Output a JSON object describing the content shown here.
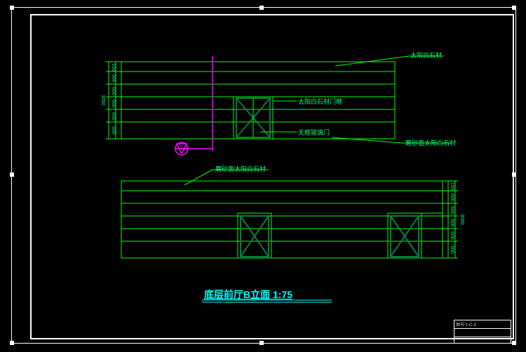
{
  "drawing": {
    "title": "底层前厅B立面 1:75",
    "scale": "1:75",
    "labels": {
      "top_stone": "太阳白石材",
      "door_frame": "太阳白石材门框",
      "glass_door": "无框玻璃门",
      "polished_stone": "磨砂面太阳白石材",
      "polished_stone2": "磨砂面太阳白石材"
    },
    "dims_upper": {
      "total": "3050",
      "d1": "500",
      "d2": "600",
      "d3": "600",
      "d4": "600",
      "d5": "600",
      "d6": "150"
    },
    "dims_lower": {
      "total": "3050",
      "d1": "500",
      "d2": "600",
      "d3": "600",
      "d4": "600",
      "d5": "600",
      "d6": "150"
    },
    "section_mark": "1"
  },
  "titleblock": {
    "line1": "图号  1-C-3",
    "line2": "",
    "line3": ""
  }
}
